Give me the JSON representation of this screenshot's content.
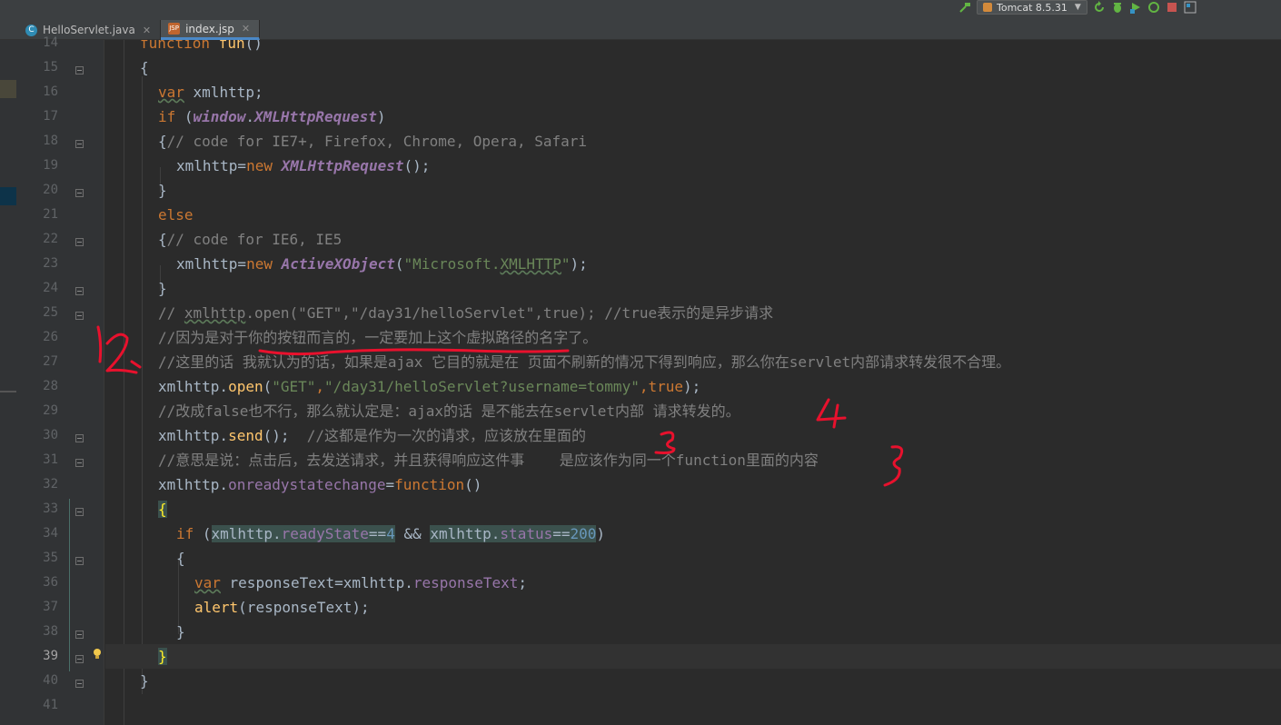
{
  "tabs": [
    {
      "label": "HelloServlet.java",
      "icon": "java-class-icon",
      "active": false
    },
    {
      "label": "index.jsp",
      "icon": "jsp-file-icon",
      "active": true
    }
  ],
  "toolbar": {
    "run_config": "Tomcat 8.5.31"
  },
  "gutter": {
    "line_numbers": [
      "14",
      "15",
      "16",
      "17",
      "18",
      "19",
      "20",
      "21",
      "22",
      "23",
      "24",
      "25",
      "26",
      "27",
      "28",
      "29",
      "30",
      "31",
      "32",
      "33",
      "34",
      "35",
      "36",
      "37",
      "38",
      "39",
      "40",
      "41"
    ],
    "current_line": "39"
  },
  "code": {
    "l14": [
      "function",
      " ",
      "fun",
      "()"
    ],
    "l15": "{",
    "l16": [
      "var",
      " xmlhttp;"
    ],
    "l17": [
      "if",
      " (",
      "window",
      ".",
      "XMLHttpRequest",
      ")"
    ],
    "l18": [
      "{",
      "// code for IE7+, Firefox, Chrome, Opera, Safari"
    ],
    "l19": [
      "xmlhttp=",
      "new",
      " ",
      "XMLHttpRequest",
      "();"
    ],
    "l20": "}",
    "l21": "else",
    "l22": [
      "{",
      "// code for IE6, IE5"
    ],
    "l23": [
      "xmlhttp=",
      "new",
      " ",
      "ActiveXObject",
      "(",
      "\"Microsoft.",
      "XMLHTTP",
      "\"",
      ");"
    ],
    "l24": "}",
    "l25": [
      "// ",
      "xmlhttp",
      ".open(\"GET\",\"/day31/helloServlet\",true); //true表示的是异步请求"
    ],
    "l26": "//因为是对于你的按钮而言的，一定要加上这个虚拟路径的名字了。",
    "l27": "//这里的话 我就认为的话，如果是ajax 它目的就是在 页面不刷新的情况下得到响应，那么你在servlet内部请求转发很不合理。",
    "l28": [
      "xmlhttp.",
      "open",
      "(",
      "\"GET\"",
      ",",
      "\"/day31/helloServlet?username=tommy\"",
      ",",
      "true",
      ");"
    ],
    "l29": "//改成false也不行，那么就认定是：ajax的话 是不能去在servlet内部 请求转发的。",
    "l30": [
      "xmlhttp.",
      "send",
      "();",
      "  ",
      "//这都是作为一次的请求，应该放在里面的"
    ],
    "l31": "//意思是说：点击后，去发送请求，并且获得响应这件事    是应该作为同一个function里面的内容",
    "l32": [
      "xmlhttp.",
      "onreadystatechange",
      "=",
      "function",
      "()"
    ],
    "l33": "{",
    "l34": [
      "if",
      " (",
      "xmlhttp.",
      "readyState",
      "==",
      "4",
      " && ",
      "xmlhttp.",
      "status",
      "==",
      "200",
      ")"
    ],
    "l35": "{",
    "l36": [
      "var",
      " responseText=xmlhttp.",
      "responseText",
      ";"
    ],
    "l37": [
      "alert",
      "(responseText);"
    ],
    "l38": "}",
    "l39": "}",
    "l40": "}",
    "l41": ""
  },
  "colors": {
    "keyword": "#cc7832",
    "comment": "#808080",
    "string": "#6a8759",
    "property": "#9876aa",
    "number": "#6897bb",
    "annotation": "#e8112d"
  }
}
